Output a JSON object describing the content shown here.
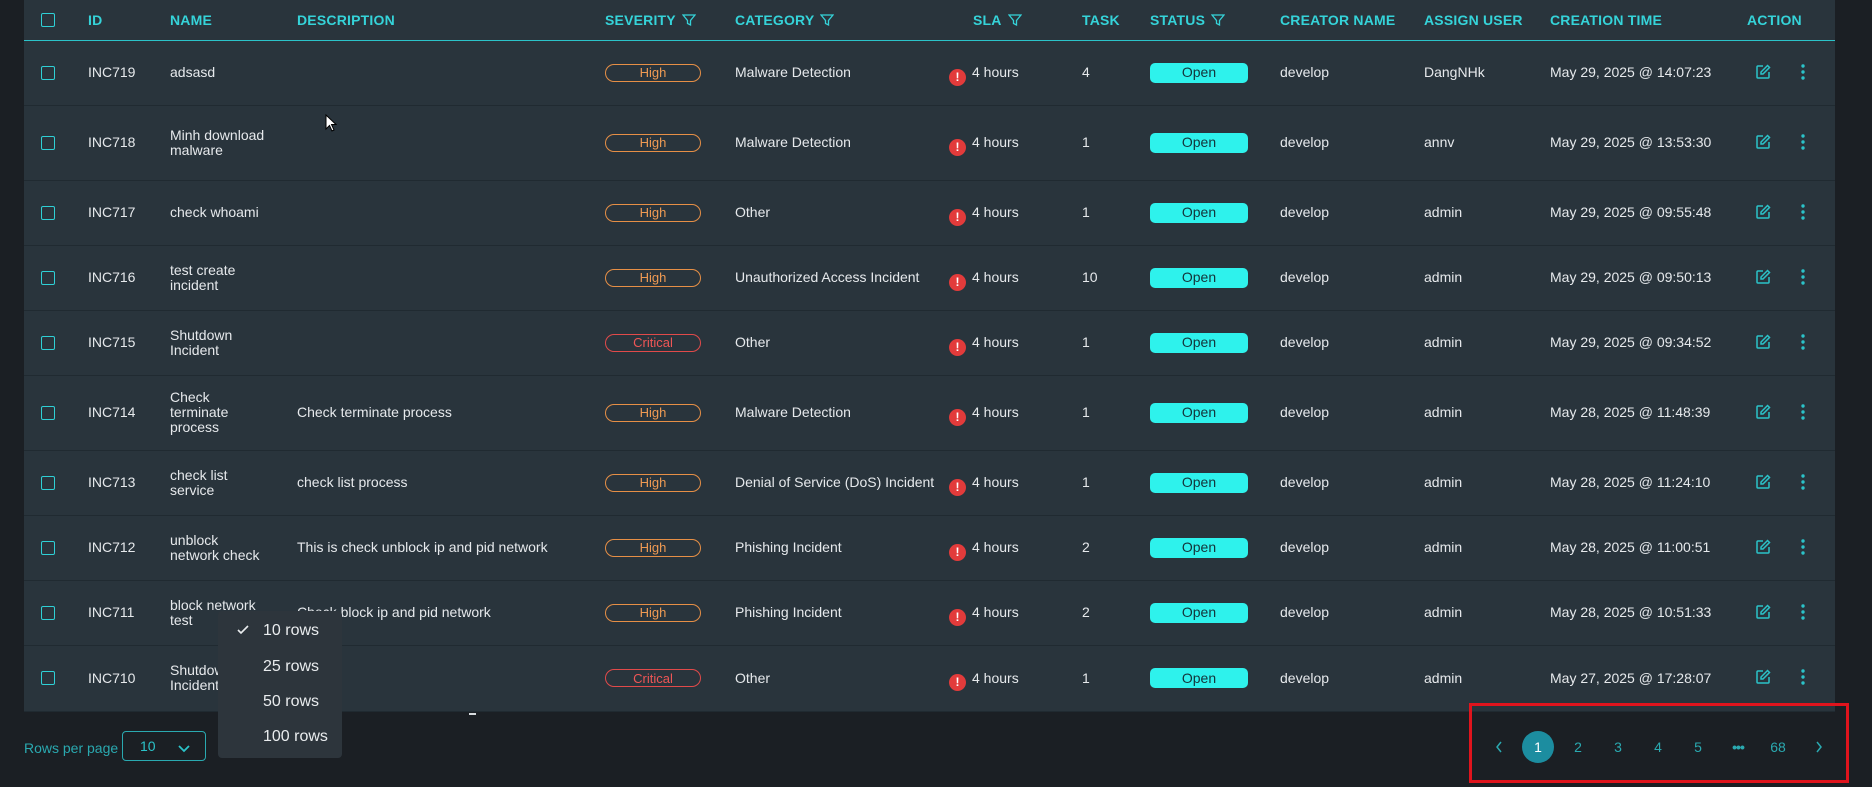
{
  "table": {
    "columns": {
      "id": "ID",
      "name": "NAME",
      "description": "DESCRIPTION",
      "severity": "SEVERITY",
      "category": "CATEGORY",
      "sla": "SLA",
      "task": "TASK",
      "status": "STATUS",
      "creator": "CREATOR NAME",
      "assign": "ASSIGN USER",
      "created": "CREATION TIME",
      "action": "ACTION"
    },
    "rows": [
      {
        "id": "INC719",
        "name": "adsasd",
        "description": "",
        "severity": "High",
        "category": "Malware Detection",
        "sla": "4 hours",
        "task": "4",
        "status": "Open",
        "creator": "develop",
        "assign": "DangNHk",
        "created": "May 29, 2025 @ 14:07:23"
      },
      {
        "id": "INC718",
        "name": "Minh download malware",
        "description": "",
        "severity": "High",
        "category": "Malware Detection",
        "sla": "4 hours",
        "task": "1",
        "status": "Open",
        "creator": "develop",
        "assign": "annv",
        "created": "May 29, 2025 @ 13:53:30"
      },
      {
        "id": "INC717",
        "name": "check whoami",
        "description": "",
        "severity": "High",
        "category": "Other",
        "sla": "4 hours",
        "task": "1",
        "status": "Open",
        "creator": "develop",
        "assign": "admin",
        "created": "May 29, 2025 @ 09:55:48"
      },
      {
        "id": "INC716",
        "name": "test create incident",
        "description": "",
        "severity": "High",
        "category": "Unauthorized Access Incident",
        "sla": "4 hours",
        "task": "10",
        "status": "Open",
        "creator": "develop",
        "assign": "admin",
        "created": "May 29, 2025 @ 09:50:13"
      },
      {
        "id": "INC715",
        "name": "Shutdown Incident",
        "description": "",
        "severity": "Critical",
        "category": "Other",
        "sla": "4 hours",
        "task": "1",
        "status": "Open",
        "creator": "develop",
        "assign": "admin",
        "created": "May 29, 2025 @ 09:34:52"
      },
      {
        "id": "INC714",
        "name": "Check terminate process",
        "description": "Check terminate process",
        "severity": "High",
        "category": "Malware Detection",
        "sla": "4 hours",
        "task": "1",
        "status": "Open",
        "creator": "develop",
        "assign": "admin",
        "created": "May 28, 2025 @ 11:48:39"
      },
      {
        "id": "INC713",
        "name": "check list service",
        "description": "check list process",
        "severity": "High",
        "category": "Denial of Service (DoS) Incident",
        "sla": "4 hours",
        "task": "1",
        "status": "Open",
        "creator": "develop",
        "assign": "admin",
        "created": "May 28, 2025 @ 11:24:10"
      },
      {
        "id": "INC712",
        "name": "unblock network check",
        "description": "This is check unblock ip and pid network",
        "severity": "High",
        "category": "Phishing Incident",
        "sla": "4 hours",
        "task": "2",
        "status": "Open",
        "creator": "develop",
        "assign": "admin",
        "created": "May 28, 2025 @ 11:00:51"
      },
      {
        "id": "INC711",
        "name": "block network test",
        "description": "Check block ip and pid network",
        "severity": "High",
        "category": "Phishing Incident",
        "sla": "4 hours",
        "task": "2",
        "status": "Open",
        "creator": "develop",
        "assign": "admin",
        "created": "May 28, 2025 @ 10:51:33"
      },
      {
        "id": "INC710",
        "name": "Shutdown Incident",
        "description": "",
        "severity": "Critical",
        "category": "Other",
        "sla": "4 hours",
        "task": "1",
        "status": "Open",
        "creator": "develop",
        "assign": "admin",
        "created": "May 27, 2025 @ 17:28:07"
      }
    ]
  },
  "footer": {
    "rows_per_page_label": "Rows per page",
    "rows_per_page_value": "10",
    "options": [
      "10 rows",
      "25 rows",
      "50 rows",
      "100 rows"
    ],
    "selected_option": "10 rows"
  },
  "pagination": {
    "pages": [
      "1",
      "2",
      "3",
      "4",
      "5"
    ],
    "ellipsis": "•••",
    "last_page": "68",
    "current": "1"
  },
  "colors": {
    "accent": "#2bc3c9",
    "status_open": "#2ef2ec",
    "severity_high": "#ef9a53",
    "severity_critical": "#ef5656",
    "highlight_box": "#e0141d"
  }
}
